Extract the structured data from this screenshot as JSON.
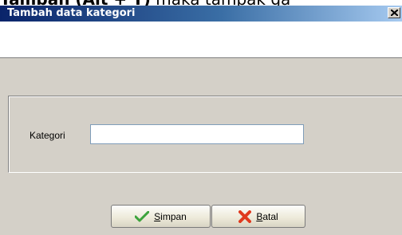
{
  "background_doc": {
    "prefix": "",
    "hotkey_bold": "Tambah (Alt + T)",
    "suffix": " maka tampak ga"
  },
  "window": {
    "title": "Tambah data kategori",
    "close_icon": "close-icon"
  },
  "form": {
    "kategori_label": "Kategori",
    "kategori_value": "",
    "kategori_placeholder": ""
  },
  "buttons": {
    "save": {
      "mnemonic": "S",
      "rest": "impan",
      "icon": "checkmark-icon",
      "icon_color": "#3ca33c"
    },
    "cancel": {
      "mnemonic": "B",
      "rest": "atal",
      "icon": "cross-icon",
      "icon_color": "#e03a1e"
    }
  },
  "colors": {
    "titlebar_start": "#0a246a",
    "titlebar_end": "#a6caf0",
    "dialog_bg": "#d4d0c8"
  }
}
